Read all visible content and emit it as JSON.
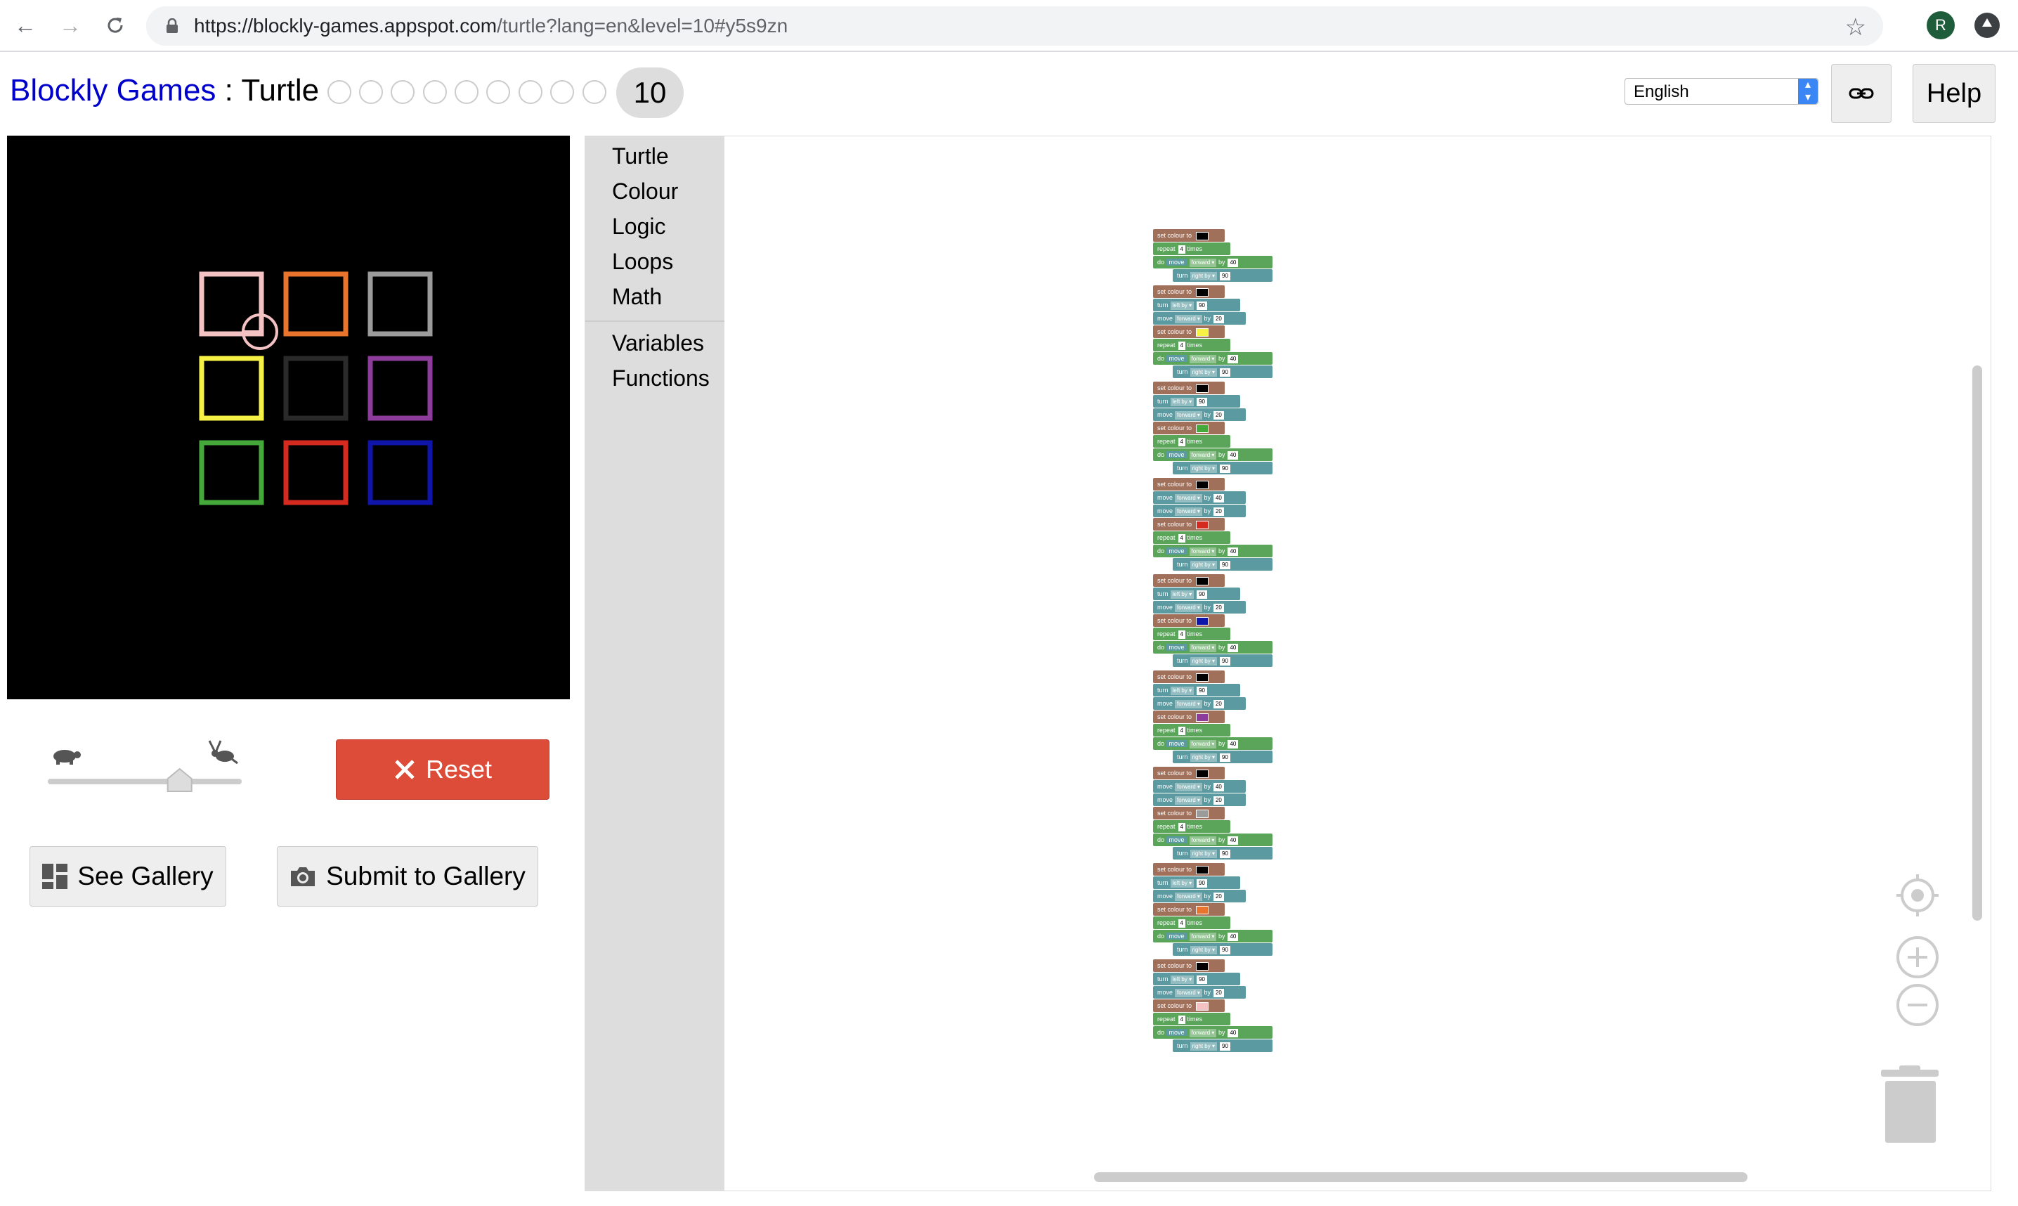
{
  "browser": {
    "url_host": "https://blockly-games.appspot.com",
    "url_path": "/turtle?lang=en&level=10#y5s9zn",
    "profile_initial": "R"
  },
  "header": {
    "games_link": "Blockly Games",
    "separator": " : ",
    "game_name": "Turtle",
    "current_level": "10",
    "language_selected": "English",
    "help_label": "Help",
    "link_icon": "link-icon"
  },
  "controls": {
    "reset_label": "Reset",
    "see_gallery_label": "See Gallery",
    "submit_gallery_label": "Submit to Gallery",
    "speed_level": 0.68
  },
  "toolbox": {
    "categories": [
      "Turtle",
      "Colour",
      "Logic",
      "Loops",
      "Math"
    ],
    "categories2": [
      "Variables",
      "Functions"
    ]
  },
  "canvas": {
    "squares": [
      {
        "color": "#f4c2c2"
      },
      {
        "color": "#e8742d"
      },
      {
        "color": "#9b9b9b"
      },
      {
        "color": "#f5f245"
      },
      {
        "color": "#2a2a2a"
      },
      {
        "color": "#8e3c9c"
      },
      {
        "color": "#44a83a"
      },
      {
        "color": "#d42a1f"
      },
      {
        "color": "#0f15a8"
      }
    ]
  },
  "blocks": {
    "set_colour": "set colour to",
    "repeat": "repeat",
    "times": "times",
    "do": "do",
    "move": "move",
    "forward": "forward",
    "by": "by",
    "turn": "turn",
    "right_by": "right by",
    "left_by": "left by",
    "n4": "4",
    "n40": "40",
    "n90": "90",
    "n20": "20"
  },
  "colors": {
    "reset_red": "#dd4b39",
    "link_blue": "#0000cc",
    "turtle_green": "#5ba55b",
    "colour_brown": "#a0705a",
    "move_teal": "#5b9aa0"
  }
}
